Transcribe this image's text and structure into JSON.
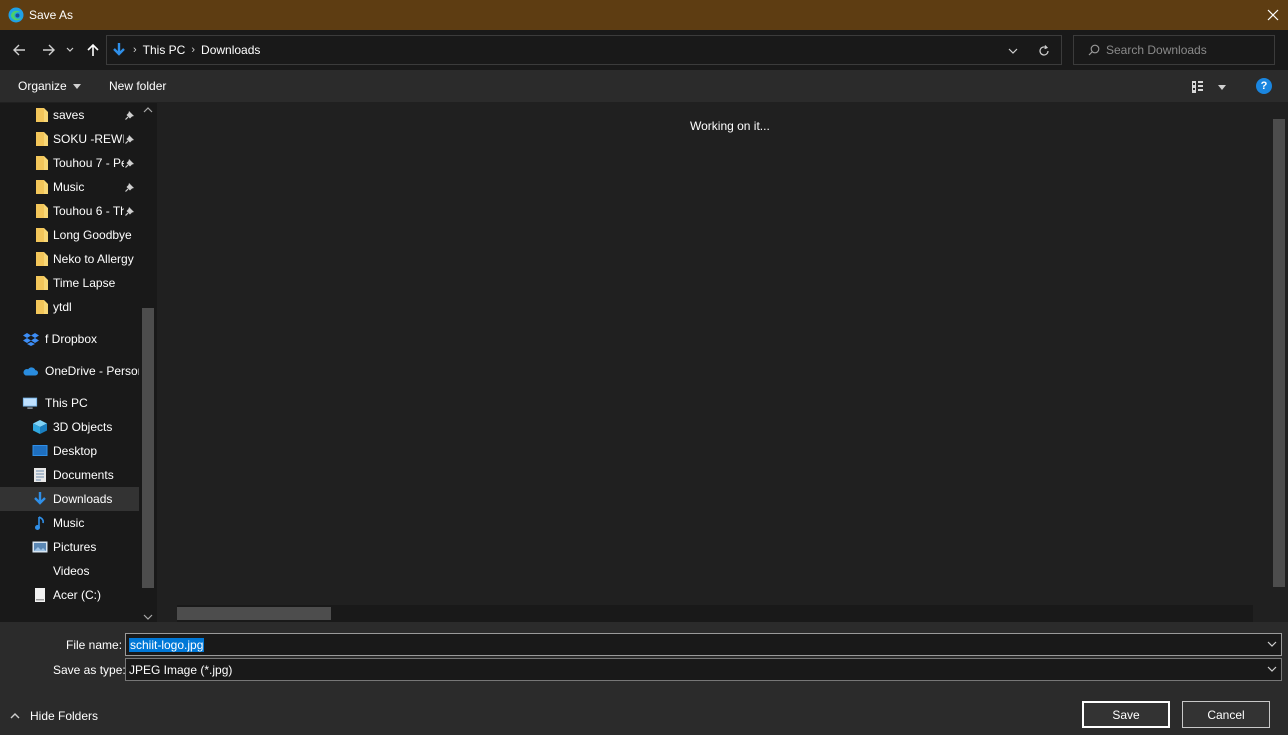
{
  "window": {
    "title": "Save As"
  },
  "address": {
    "crumbs": [
      "This PC",
      "Downloads"
    ]
  },
  "search": {
    "placeholder": "Search Downloads"
  },
  "toolbar": {
    "organize_label": "Organize",
    "new_folder_label": "New folder",
    "help_label": "?"
  },
  "sidebar": {
    "quick_access": [
      {
        "label": "saves",
        "pinned": true
      },
      {
        "label": "SOKU -REWIF",
        "pinned": true
      },
      {
        "label": "Touhou 7 - Pe",
        "pinned": true
      },
      {
        "label": "Music",
        "pinned": true
      },
      {
        "label": "Touhou 6 - Th",
        "pinned": true
      },
      {
        "label": "Long Goodbye",
        "pinned": false
      },
      {
        "label": "Neko to Allergy",
        "pinned": false
      },
      {
        "label": "Time Lapse",
        "pinned": false
      },
      {
        "label": "ytdl",
        "pinned": false
      }
    ],
    "dropbox": "f Dropbox",
    "onedrive": "OneDrive - Person",
    "this_pc": "This PC",
    "pc_items": [
      {
        "label": "3D Objects",
        "icon": "cube-icon"
      },
      {
        "label": "Desktop",
        "icon": "desktop-icon"
      },
      {
        "label": "Documents",
        "icon": "documents-icon"
      },
      {
        "label": "Downloads",
        "icon": "download-arrow-icon",
        "selected": true
      },
      {
        "label": "Music",
        "icon": "music-note-icon"
      },
      {
        "label": "Pictures",
        "icon": "pictures-icon"
      },
      {
        "label": "Videos",
        "icon": ""
      },
      {
        "label": "Acer (C:)",
        "icon": "drive-icon"
      }
    ]
  },
  "content": {
    "status": "Working on it..."
  },
  "form": {
    "filename_label": "File name:",
    "filename_value": "schiit-logo.jpg",
    "type_label": "Save as type:",
    "type_value": "JPEG Image (*.jpg)",
    "save_label": "Save",
    "cancel_label": "Cancel",
    "hide_folders_label": "Hide Folders"
  },
  "colors": {
    "titlebar": "#5e3d12",
    "accent": "#0078d7",
    "folder": "#f8d775"
  }
}
